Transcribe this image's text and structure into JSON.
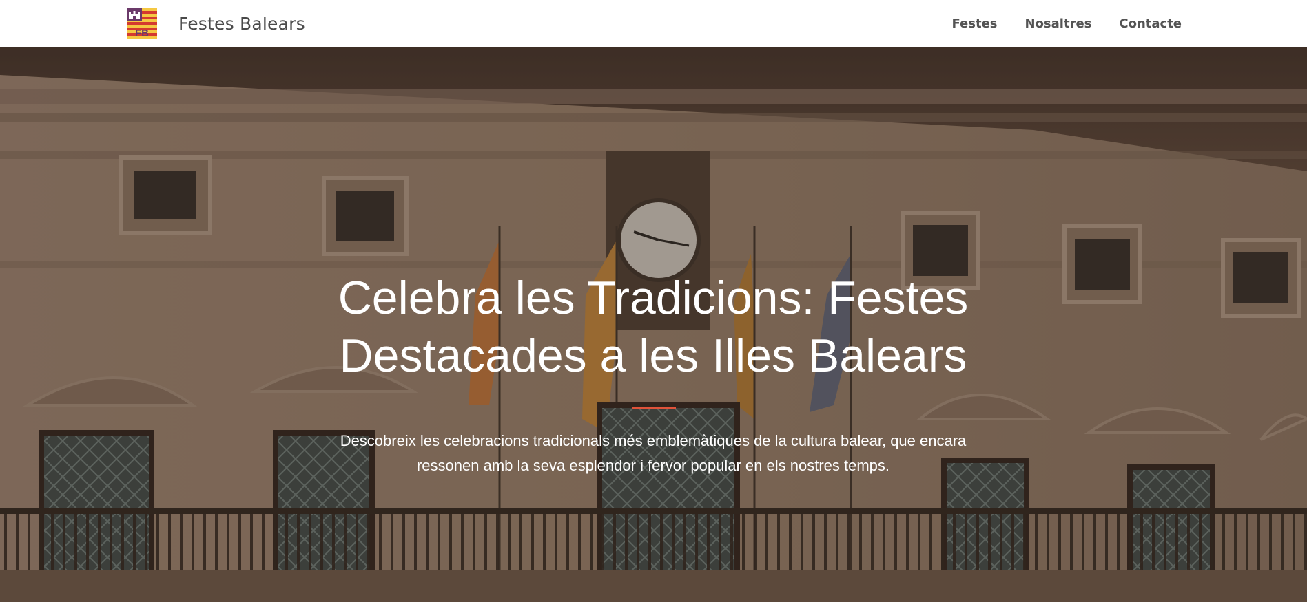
{
  "navbar": {
    "brand_name": "Festes Balears",
    "logo_letters": "FB",
    "links": [
      "Festes",
      "Nosaltres",
      "Contacte"
    ]
  },
  "hero": {
    "title": "Celebra les Tradicions: Festes Destacades a les Illes Balears",
    "subtitle": "Descobreix les celebracions tradicionals més emblemàtiques de la cultura balear, que encara ressonen amb la seva esplendor i fervor popular en els nostres temps."
  },
  "colors": {
    "accent": "#e0533a",
    "logo_yellow": "#f5c842",
    "logo_red": "#d43a2f",
    "logo_purple": "#6b3a6a",
    "nav_text": "#545454"
  },
  "icons": {
    "logo": "balearic-flag-logo-icon"
  }
}
